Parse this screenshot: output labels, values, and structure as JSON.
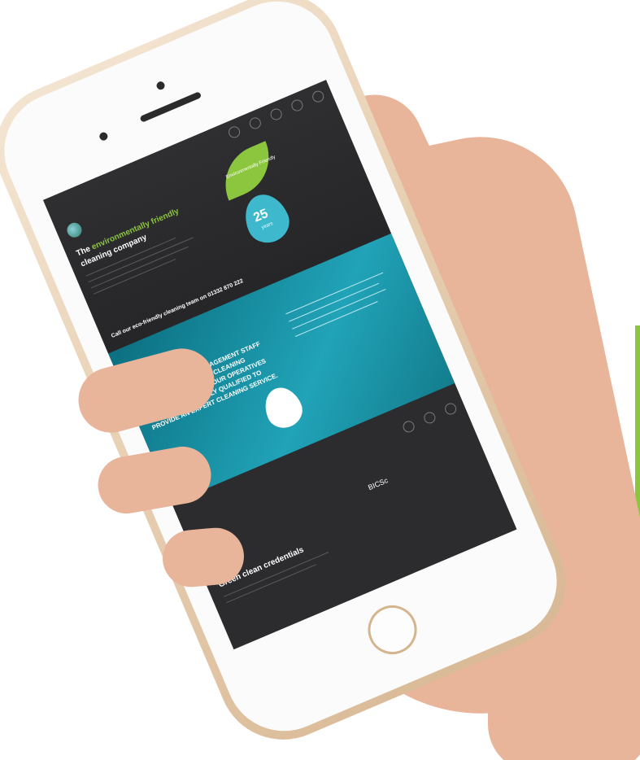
{
  "scene": {
    "colors": {
      "background": "#ffffff",
      "phone_gold": "#e9d2b6",
      "screen_dark": "#2a2a2c",
      "teal": "#21a3b8",
      "green": "#8cc63f",
      "skin": "#e8b49a"
    }
  },
  "screen": {
    "section1": {
      "heading_prefix": "The",
      "heading_highlight": "environmentally friendly",
      "heading_suffix": "cleaning company",
      "leaf_text": "Environmentally Friendly",
      "drop_number": "25",
      "drop_text": "years",
      "call_text": "Call our eco-friendly cleaning team on",
      "phone": "01332 870 222"
    },
    "section2": {
      "headline": "FROM WASHROOM MANAGEMENT STAFF TO ABSEILING WINDOW CLEANING TECHNICIANS, ALL OF OUR OPERATIVES ARE PROFESSIONALLY QUALIFIED TO PROVIDE AN EXPERT CLEANING SERVICE."
    },
    "section3": {
      "heading": "Green clean credentials",
      "badge": "BICSc"
    }
  }
}
